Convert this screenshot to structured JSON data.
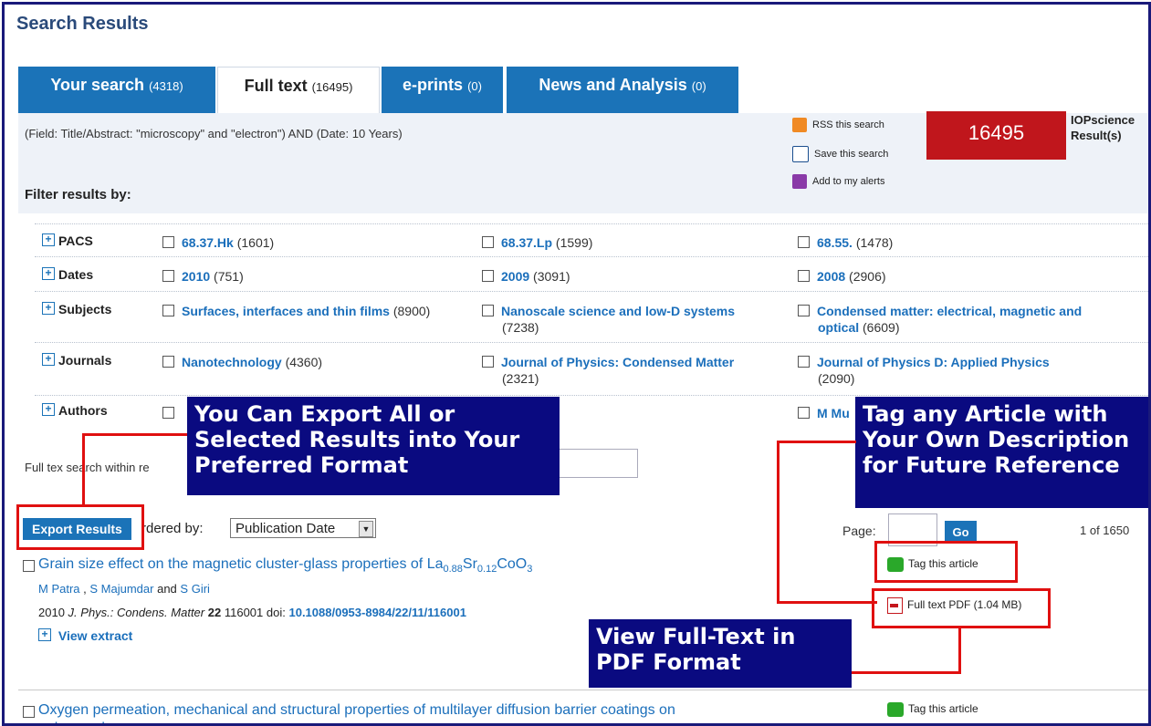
{
  "page_title": "Search Results",
  "tabs": [
    {
      "label": "Your search",
      "count": "(4318)"
    },
    {
      "label": "Full text",
      "count": "(16495)"
    },
    {
      "label": "e-prints",
      "count": "(0)"
    },
    {
      "label": "News and Analysis",
      "count": "(0)"
    }
  ],
  "query": "(Field: Title/Abstract: \"microscopy\" and \"electron\") AND (Date: 10 Years)",
  "actions": {
    "rss": "RSS this search",
    "save": "Save this search",
    "alerts": "Add to my alerts"
  },
  "result_count": "16495",
  "result_source": "IOPscience",
  "result_label": "Result(s)",
  "filter_title": "Filter results by:",
  "filters": [
    {
      "label": "PACS",
      "options": [
        {
          "name": "68.37.Hk",
          "count": "(1601)"
        },
        {
          "name": "68.37.Lp",
          "count": "(1599)"
        },
        {
          "name": "68.55.",
          "count": "(1478)"
        }
      ]
    },
    {
      "label": "Dates",
      "options": [
        {
          "name": "2010",
          "count": "(751)"
        },
        {
          "name": "2009",
          "count": "(3091)"
        },
        {
          "name": "2008",
          "count": "(2906)"
        }
      ]
    },
    {
      "label": "Subjects",
      "options": [
        {
          "name": "Surfaces, interfaces and thin films",
          "count": "(8900)"
        },
        {
          "name": "Nanoscale science and low-D systems",
          "count": "(7238)"
        },
        {
          "name": "Condensed matter: electrical, magnetic and optical",
          "count": "(6609)"
        }
      ]
    },
    {
      "label": "Journals",
      "options": [
        {
          "name": "Nanotechnology",
          "count": "(4360)"
        },
        {
          "name": "Journal of Physics: Condensed Matter",
          "count": "(2321)"
        },
        {
          "name": "Journal of Physics D: Applied Physics",
          "count": "(2090)"
        }
      ]
    },
    {
      "label": "Authors",
      "options": [
        {
          "name": "",
          "count": ""
        },
        {
          "name": "",
          "count": ""
        },
        {
          "name": "M Mu",
          "count": ""
        }
      ]
    }
  ],
  "fulltext_search_label": "Full tex",
  "fulltext_search_label_tail": "search within re",
  "export_button": "Export Results",
  "ordered_by_label": "Ordered by:",
  "ordered_by_visible": "rdered by:",
  "order_value": "Publication Date",
  "page_label": "Page:",
  "go_button": "Go",
  "page_count": "1 of 1650",
  "results": [
    {
      "title_prefix": "Grain size effect on the magnetic cluster-glass properties of La",
      "title_sub1": "0.88",
      "title_mid1": "Sr",
      "title_sub2": "0.12",
      "title_mid2": "CoO",
      "title_sub3": "3",
      "authors": [
        "M Patra",
        "S Majumdar",
        "S Giri"
      ],
      "author_sep1": ",",
      "author_and": "and",
      "year": "2010",
      "journal": "J. Phys.: Condens. Matter",
      "volume": "22",
      "article": "116001",
      "doi_label": "doi:",
      "doi": "10.1088/0953-8984/22/11/116001",
      "view_extract": "View extract",
      "tag": "Tag this article",
      "pdf": "Full text PDF (1.04 MB)"
    },
    {
      "title_line1": "Oxygen permeation, mechanical and structural properties of multilayer diffusion barrier coatings on",
      "title_line2": "polypropylene",
      "tag": "Tag this article"
    }
  ],
  "callouts": {
    "export": [
      "You Can Export All or",
      "Selected Results into Your",
      "Preferred Format"
    ],
    "tag": [
      "Tag any Article with",
      "Your Own Description",
      "for Future Reference"
    ],
    "pdf": [
      "View Full-Text in",
      "PDF Format"
    ]
  },
  "colors": {
    "tab_blue": "#1b73b8",
    "link_blue": "#1b6fbb",
    "count_red": "#c0161c",
    "callout_navy": "#0a0a80",
    "annotation_red": "#e01010"
  }
}
